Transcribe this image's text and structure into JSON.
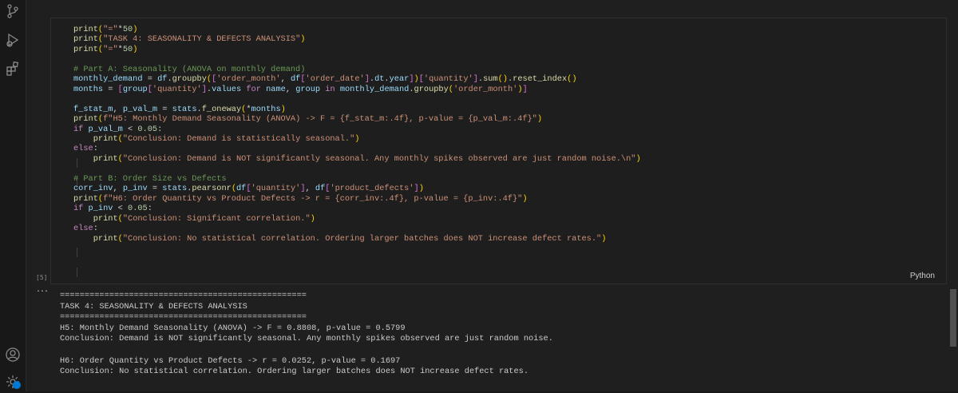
{
  "activity_bar": {
    "icons": [
      "source-control-icon",
      "run-debug-icon",
      "extensions-icon",
      "account-icon",
      "settings-gear-icon"
    ],
    "accent_color": "#0078d4"
  },
  "cell": {
    "execution_count": "[5]",
    "language": "Python",
    "code_lines": [
      "print(\"=\"*50)",
      "print(\"TASK 4: SEASONALITY & DEFECTS ANALYSIS\")",
      "print(\"=\"*50)",
      "",
      "# Part A: Seasonality (ANOVA on monthly demand)",
      "monthly_demand = df.groupby(['order_month', df['order_date'].dt.year])['quantity'].sum().reset_index()",
      "months = [group['quantity'].values for name, group in monthly_demand.groupby('order_month')]",
      "",
      "f_stat_m, p_val_m = stats.f_oneway(*months)",
      "print(f\"H5: Monthly Demand Seasonality (ANOVA) -> F = {f_stat_m:.4f}, p-value = {p_val_m:.4f}\")",
      "if p_val_m < 0.05:",
      "    print(\"Conclusion: Demand is statistically seasonal.\")",
      "else:",
      "    print(\"Conclusion: Demand is NOT significantly seasonal. Any monthly spikes observed are just random noise.\\n\")",
      "",
      "# Part B: Order Size vs Defects",
      "corr_inv, p_inv = stats.pearsonr(df['quantity'], df['product_defects'])",
      "print(f\"H6: Order Quantity vs Product Defects -> r = {corr_inv:.4f}, p-value = {p_inv:.4f}\")",
      "if p_inv < 0.05:",
      "    print(\"Conclusion: Significant correlation.\")",
      "else:",
      "    print(\"Conclusion: No statistical correlation. Ordering larger batches does NOT increase defect rates.\")"
    ]
  },
  "output": {
    "menu_label": "...",
    "lines": [
      "==================================================",
      "TASK 4: SEASONALITY & DEFECTS ANALYSIS",
      "==================================================",
      "H5: Monthly Demand Seasonality (ANOVA) -> F = 0.8808, p-value = 0.5799",
      "Conclusion: Demand is NOT significantly seasonal. Any monthly spikes observed are just random noise.",
      "",
      "H6: Order Quantity vs Product Defects -> r = 0.0252, p-value = 0.1697",
      "Conclusion: No statistical correlation. Ordering larger batches does NOT increase defect rates."
    ]
  }
}
